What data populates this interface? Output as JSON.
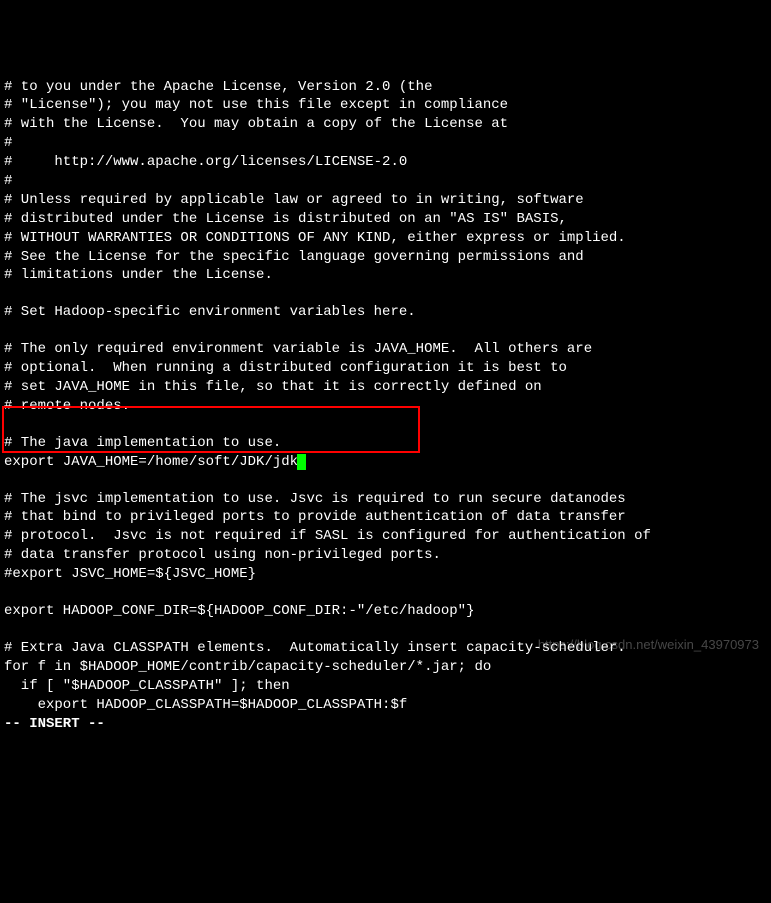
{
  "lines": [
    "# to you under the Apache License, Version 2.0 (the",
    "# \"License\"); you may not use this file except in compliance",
    "# with the License.  You may obtain a copy of the License at",
    "#",
    "#     http://www.apache.org/licenses/LICENSE-2.0",
    "#",
    "# Unless required by applicable law or agreed to in writing, software",
    "# distributed under the License is distributed on an \"AS IS\" BASIS,",
    "# WITHOUT WARRANTIES OR CONDITIONS OF ANY KIND, either express or implied.",
    "# See the License for the specific language governing permissions and",
    "# limitations under the License.",
    "",
    "# Set Hadoop-specific environment variables here.",
    "",
    "# The only required environment variable is JAVA_HOME.  All others are",
    "# optional.  When running a distributed configuration it is best to",
    "# set JAVA_HOME in this file, so that it is correctly defined on",
    "# remote nodes.",
    "",
    "# The java implementation to use.",
    "export JAVA_HOME=/home/soft/JDK/jdk",
    "",
    "# The jsvc implementation to use. Jsvc is required to run secure datanodes",
    "# that bind to privileged ports to provide authentication of data transfer",
    "# protocol.  Jsvc is not required if SASL is configured for authentication of",
    "# data transfer protocol using non-privileged ports.",
    "#export JSVC_HOME=${JSVC_HOME}",
    "",
    "export HADOOP_CONF_DIR=${HADOOP_CONF_DIR:-\"/etc/hadoop\"}",
    "",
    "# Extra Java CLASSPATH elements.  Automatically insert capacity-scheduler.",
    "for f in $HADOOP_HOME/contrib/capacity-scheduler/*.jar; do",
    "  if [ \"$HADOOP_CLASSPATH\" ]; then",
    "    export HADOOP_CLASSPATH=$HADOOP_CLASSPATH:$f"
  ],
  "cursor_line_index": 20,
  "mode_line": "-- INSERT --",
  "watermark": "https://blog.csdn.net/weixin_43970973"
}
